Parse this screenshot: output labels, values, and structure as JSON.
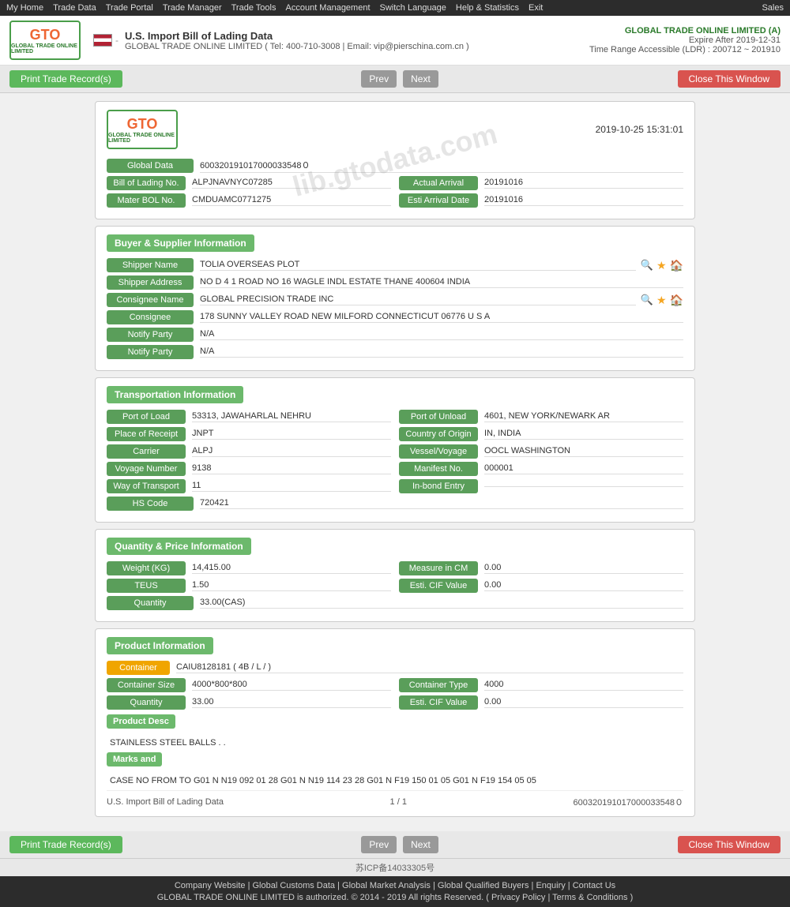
{
  "topnav": {
    "items": [
      "My Home",
      "Trade Data",
      "Trade Portal",
      "Trade Manager",
      "Trade Tools",
      "Account Management",
      "Switch Language",
      "Help & Statistics",
      "Exit"
    ],
    "right": "Sales"
  },
  "header": {
    "logo_text": "GTO",
    "logo_sub": "GLOBAL TRADE ONLINE LIMITED",
    "title": "U.S. Import Bill of Lading Data",
    "subtitle_phone": "GLOBAL TRADE ONLINE LIMITED ( Tel: 400-710-3008 | Email: vip@pierschina.com.cn )",
    "company": "GLOBAL TRADE ONLINE LIMITED (A)",
    "expire": "Expire After 2019-12-31",
    "time_range": "Time Range Accessible (LDR) : 200712 ~ 201910"
  },
  "actions": {
    "print_label": "Print Trade Record(s)",
    "prev_label": "Prev",
    "next_label": "Next",
    "close_label": "Close This Window"
  },
  "document": {
    "timestamp": "2019-10-25 15:31:01",
    "global_data_label": "Global Data",
    "global_data_value": "600320191017000033548０",
    "bol_label": "Bill of Lading No.",
    "bol_value": "ALPJNAVNYC07285",
    "actual_arrival_label": "Actual Arrival",
    "actual_arrival_value": "20191016",
    "master_bol_label": "Mater BOL No.",
    "master_bol_value": "CMDUAMC0771275",
    "esti_arrival_label": "Esti Arrival Date",
    "esti_arrival_value": "20191016"
  },
  "buyer_supplier": {
    "section_title": "Buyer & Supplier Information",
    "shipper_name_label": "Shipper Name",
    "shipper_name_value": "TOLIA OVERSEAS PLOT",
    "shipper_address_label": "Shipper Address",
    "shipper_address_value": "NO D 4 1 ROAD NO 16 WAGLE INDL ESTATE THANE 400604 INDIA",
    "consignee_name_label": "Consignee Name",
    "consignee_name_value": "GLOBAL PRECISION TRADE INC",
    "consignee_label": "Consignee",
    "consignee_value": "178 SUNNY VALLEY ROAD NEW MILFORD CONNECTICUT 06776 U S A",
    "notify_party_label": "Notify Party",
    "notify_party_value1": "N/A",
    "notify_party_value2": "N/A"
  },
  "transportation": {
    "section_title": "Transportation Information",
    "port_load_label": "Port of Load",
    "port_load_value": "53313, JAWAHARLAL NEHRU",
    "port_unload_label": "Port of Unload",
    "port_unload_value": "4601, NEW YORK/NEWARK AR",
    "place_receipt_label": "Place of Receipt",
    "place_receipt_value": "JNPT",
    "country_origin_label": "Country of Origin",
    "country_origin_value": "IN, INDIA",
    "carrier_label": "Carrier",
    "carrier_value": "ALPJ",
    "vessel_label": "Vessel/Voyage",
    "vessel_value": "OOCL WASHINGTON",
    "voyage_label": "Voyage Number",
    "voyage_value": "9138",
    "manifest_label": "Manifest No.",
    "manifest_value": "000001",
    "way_transport_label": "Way of Transport",
    "way_transport_value": "11",
    "inbond_label": "In-bond Entry",
    "inbond_value": "",
    "hs_code_label": "HS Code",
    "hs_code_value": "720421"
  },
  "quantity_price": {
    "section_title": "Quantity & Price Information",
    "weight_label": "Weight (KG)",
    "weight_value": "14,415.00",
    "measure_label": "Measure in CM",
    "measure_value": "0.00",
    "teus_label": "TEUS",
    "teus_value": "1.50",
    "cif_label": "Esti. CIF Value",
    "cif_value": "0.00",
    "quantity_label": "Quantity",
    "quantity_value": "33.00(CAS)"
  },
  "product_info": {
    "section_title": "Product Information",
    "container_label": "Container",
    "container_value": "CAIU8128181 ( 4B / L / )",
    "container_size_label": "Container Size",
    "container_size_value": "4000*800*800",
    "container_type_label": "Container Type",
    "container_type_value": "4000",
    "quantity_label": "Quantity",
    "quantity_value": "33.00",
    "cif_label": "Esti. CIF Value",
    "cif_value": "0.00",
    "product_desc_label": "Product Desc",
    "product_desc_value": "STAINLESS STEEL BALLS . .",
    "marks_label": "Marks and",
    "marks_value": "CASE NO FROM TO G01 N N19 092 01 28 G01 N N19 114 23 28 G01 N F19 150 01 05 G01 N F19 154 05 05"
  },
  "footer": {
    "page_label": "U.S. Import Bill of Lading Data",
    "page_num": "1 / 1",
    "record_id": "600320191017000033548０"
  },
  "site_footer": {
    "links": [
      "Company Website",
      "Global Customs Data",
      "Global Market Analysis",
      "Global Qualified Buyers",
      "Enquiry",
      "Contact Us"
    ],
    "copyright": "GLOBAL TRADE ONLINE LIMITED is authorized. © 2014 - 2019 All rights Reserved.  ( Privacy Policy | Terms & Conditions )",
    "icp": "苏ICP备14033305号"
  },
  "watermark": "lib.gtodata.com"
}
